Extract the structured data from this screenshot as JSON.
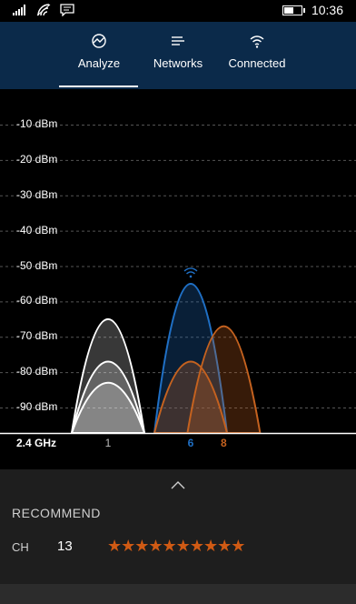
{
  "status_bar": {
    "time": "10:36",
    "icons": [
      "signal-bars-icon",
      "wifi-icon",
      "message-icon",
      "battery-icon"
    ],
    "battery_level": 0.55
  },
  "tabs": [
    {
      "label": "Analyze",
      "icon": "analyze-icon",
      "selected": true
    },
    {
      "label": "Networks",
      "icon": "networks-list-icon",
      "selected": false
    },
    {
      "label": "Connected",
      "icon": "wifi-icon",
      "selected": false
    }
  ],
  "chart_data": {
    "type": "area",
    "band_label": "2.4 GHz",
    "y_ticks": [
      "-10 dBm",
      "-20 dBm",
      "-30 dBm",
      "-40 dBm",
      "-50 dBm",
      "-60 dBm",
      "-70 dBm",
      "-80 dBm",
      "-90 dBm"
    ],
    "ylim": [
      -100,
      -5
    ],
    "x_ticks": [
      {
        "label": "1",
        "channel": 1,
        "color": "#bbbbbb"
      },
      {
        "label": "6",
        "channel": 6,
        "color": "#1f6fc4"
      },
      {
        "label": "8",
        "channel": 8,
        "color": "#c5621f"
      }
    ],
    "xlim": [
      -2,
      15
    ],
    "grid": true,
    "series": [
      {
        "channel": 1,
        "dbm": -65,
        "color": "#ffffff"
      },
      {
        "channel": 1,
        "dbm": -77,
        "color": "#ffffff"
      },
      {
        "channel": 1,
        "dbm": -83,
        "color": "#ffffff"
      },
      {
        "channel": 6,
        "dbm": -55,
        "color": "#1f6fc4",
        "connected": true
      },
      {
        "channel": 6,
        "dbm": -77,
        "color": "#c5621f"
      },
      {
        "channel": 8,
        "dbm": -67,
        "color": "#c5621f"
      }
    ],
    "colors": {
      "white": "#ffffff",
      "blue": "#1f6fc4",
      "orange": "#c5621f",
      "grid": "#555555"
    }
  },
  "recommend": {
    "title": "RECOMMEND",
    "ch_label": "CH",
    "ch_value": "13",
    "stars": "★★★★★★★★★★",
    "star_count": 10,
    "star_color": "#d05a14"
  }
}
